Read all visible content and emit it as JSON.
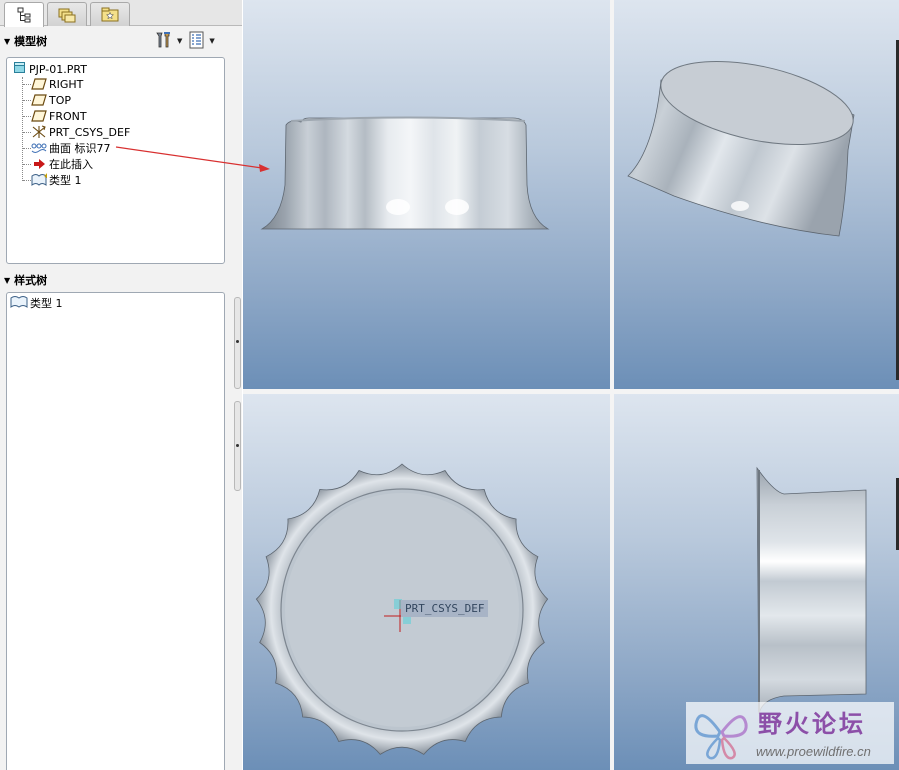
{
  "colors": {
    "viewport_top": "#dde5ef",
    "viewport_bottom": "#6c8fb7",
    "part_surface": "#c9d1d9",
    "annotation_arrow": "#d83030",
    "watermark_purple": "#8c4fa8"
  },
  "tabs": [
    {
      "icon": "model-tree-icon"
    },
    {
      "icon": "folder-browser-icon"
    },
    {
      "icon": "favorites-icon"
    }
  ],
  "model_tree": {
    "header": "模型树",
    "tools": [
      {
        "icon": "settings-tools-icon"
      },
      {
        "icon": "show-options-icon"
      }
    ],
    "root": {
      "label": "PJP-01.PRT",
      "icon": "part-icon"
    },
    "items": [
      {
        "label": "RIGHT",
        "icon": "datum-plane-icon"
      },
      {
        "label": "TOP",
        "icon": "datum-plane-icon"
      },
      {
        "label": "FRONT",
        "icon": "datum-plane-icon"
      },
      {
        "label": "PRT_CSYS_DEF",
        "icon": "coordinate-system-icon"
      },
      {
        "label": "曲面 标识77",
        "icon": "surface-quilt-icon"
      },
      {
        "label": "在此插入",
        "icon": "insert-here-arrow-icon"
      },
      {
        "label": "类型 1",
        "icon": "style-feature-icon"
      }
    ]
  },
  "layer_tree": {
    "header": "样式树",
    "items": [
      {
        "label": "类型 1",
        "icon": "style-feature-icon"
      }
    ]
  },
  "viewports": {
    "top_view_csys_label": "PRT_CSYS_DEF"
  },
  "watermark": {
    "title": "野火论坛",
    "url": "www.proewildfire.cn",
    "icon": "butterfly-logo-icon"
  }
}
